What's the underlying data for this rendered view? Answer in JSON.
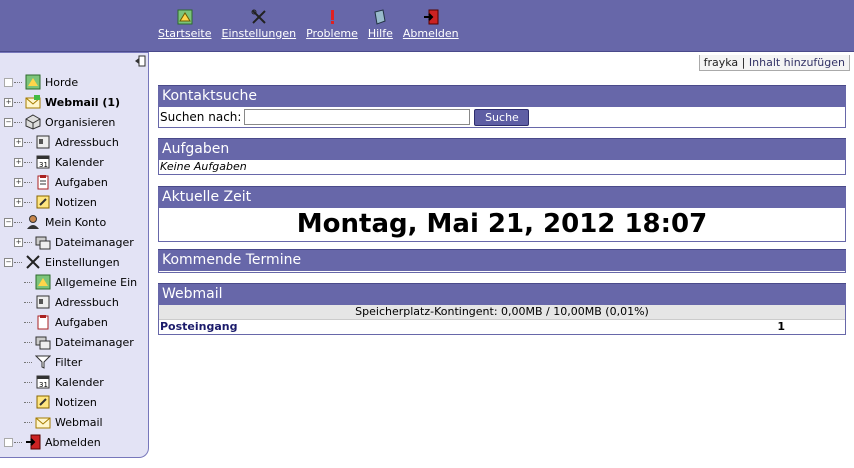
{
  "topnav": [
    {
      "label": "Startseite",
      "icon": "home-icon"
    },
    {
      "label": "Einstellungen",
      "icon": "tools-icon"
    },
    {
      "label": "Probleme",
      "icon": "exclamation-icon"
    },
    {
      "label": "Hilfe",
      "icon": "help-book-icon"
    },
    {
      "label": "Abmelden",
      "icon": "logout-icon"
    }
  ],
  "userbar": {
    "user": "frayka",
    "separator": "|",
    "add_content": "Inhalt hinzufügen"
  },
  "sidebar": {
    "horde": "Horde",
    "webmail": "Webmail (1)",
    "organisieren": "Organisieren",
    "org_items": [
      "Adressbuch",
      "Kalender",
      "Aufgaben",
      "Notizen"
    ],
    "mein_konto": "Mein Konto",
    "konto_items": [
      "Dateimanager"
    ],
    "einstellungen": "Einstellungen",
    "einst_items": [
      "Allgemeine Ein",
      "Adressbuch",
      "Aufgaben",
      "Dateimanager",
      "Filter",
      "Kalender",
      "Notizen",
      "Webmail"
    ],
    "abmelden": "Abmelden"
  },
  "kontaktsuche": {
    "title": "Kontaktsuche",
    "label": "Suchen nach:",
    "value": "",
    "button": "Suche"
  },
  "aufgaben": {
    "title": "Aufgaben",
    "empty": "Keine Aufgaben"
  },
  "zeit": {
    "title": "Aktuelle Zeit",
    "value": "Montag, Mai 21, 2012 18:07"
  },
  "termine": {
    "title": "Kommende Termine"
  },
  "webmail": {
    "title": "Webmail",
    "quota": "Speicherplatz-Kontingent: 0,00MB / 10,00MB (0,01%)",
    "inbox": "Posteingang",
    "count": "1"
  }
}
